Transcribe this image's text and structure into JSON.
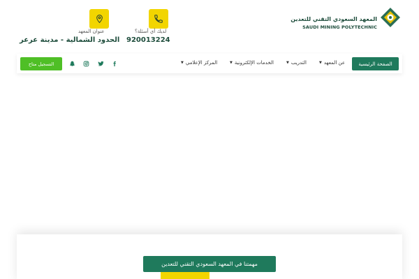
{
  "colors": {
    "primary_green": "#1f7a5c",
    "accent_yellow": "#f2d500",
    "register_green": "#4fbf26"
  },
  "logo": {
    "name_ar": "المعهد السعودي التقني للتعدين",
    "name_en": "SAUDI MINING POLYTECHNIC",
    "icon": "institute-logo-icon"
  },
  "contact": {
    "phone_caption": "لديك أي أسئلة؟",
    "phone_value": "920013224",
    "phone_icon": "phone-icon",
    "address_caption": "عنوان المعهد",
    "address_value": "الحدود الشمالية - مدينة عرعر",
    "address_icon": "location-pin-icon"
  },
  "nav": {
    "home": "الصفحة الرئيسية",
    "items": [
      "عن المعهد",
      "التدريب",
      "الخدمات الإلكترونية",
      "المركز الإعلامي"
    ],
    "social": [
      "facebook-icon",
      "twitter-icon",
      "instagram-icon",
      "snapchat-icon"
    ],
    "register": "التسجيل متاح"
  },
  "hero": {
    "mission_button": "مهمتنا في المعهد السعودي التقني للتعدين"
  }
}
